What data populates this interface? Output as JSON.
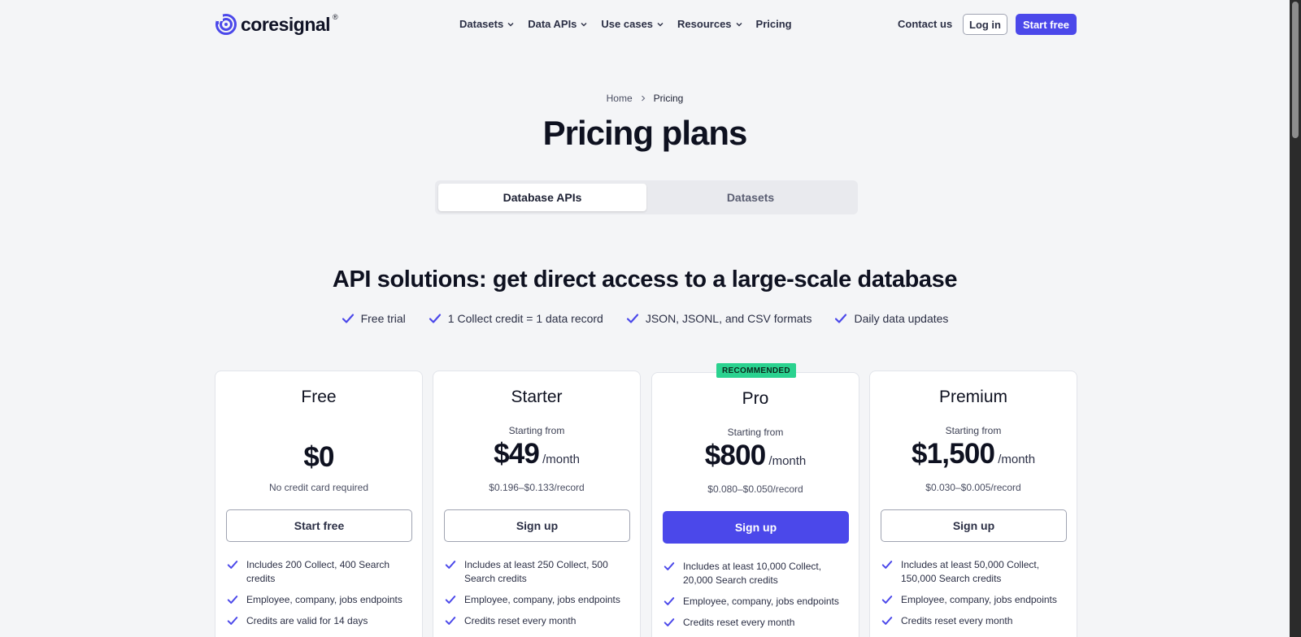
{
  "header": {
    "logo_text": "coresignal",
    "logo_reg": "®",
    "nav": [
      {
        "label": "Datasets",
        "dropdown": true
      },
      {
        "label": "Data APIs",
        "dropdown": true
      },
      {
        "label": "Use cases",
        "dropdown": true
      },
      {
        "label": "Resources",
        "dropdown": true
      },
      {
        "label": "Pricing",
        "dropdown": false
      }
    ],
    "contact": "Contact us",
    "login": "Log in",
    "start_free": "Start free"
  },
  "breadcrumb": {
    "home": "Home",
    "current": "Pricing"
  },
  "title": "Pricing plans",
  "tabs": [
    {
      "label": "Database APIs",
      "active": true
    },
    {
      "label": "Datasets",
      "active": false
    }
  ],
  "section_title": "API solutions: get direct access to a large-scale database",
  "features": [
    "Free trial",
    "1 Collect credit = 1 data record",
    "JSON, JSONL, and CSV formats",
    "Daily data updates"
  ],
  "badge": "RECOMMENDED",
  "plans": [
    {
      "name": "Free",
      "starting": "",
      "price": "$0",
      "per": "",
      "subtext": "No credit card required",
      "button": "Start free",
      "perks": [
        "Includes 200 Collect, 400 Search credits",
        "Employee, company, jobs endpoints",
        "Credits are valid for 14 days"
      ]
    },
    {
      "name": "Starter",
      "starting": "Starting from",
      "price": "$49",
      "per": "/month",
      "subtext": "$0.196–$0.133/record",
      "button": "Sign up",
      "perks": [
        "Includes at least 250 Collect, 500 Search credits",
        "Employee, company, jobs endpoints",
        "Credits reset every month"
      ]
    },
    {
      "name": "Pro",
      "starting": "Starting from",
      "price": "$800",
      "per": "/month",
      "subtext": "$0.080–$0.050/record",
      "button": "Sign up",
      "perks": [
        "Includes at least 10,000 Collect, 20,000 Search credits",
        "Employee, company, jobs endpoints",
        "Credits reset every month"
      ]
    },
    {
      "name": "Premium",
      "starting": "Starting from",
      "price": "$1,500",
      "per": "/month",
      "subtext": "$0.030–$0.005/record",
      "button": "Sign up",
      "perks": [
        "Includes at least 50,000 Collect, 150,000 Search credits",
        "Employee, company, jobs endpoints",
        "Credits reset every month"
      ]
    }
  ],
  "colors": {
    "accent": "#4b48ea",
    "badge": "#2ad28f",
    "background": "#f4f5f7"
  }
}
